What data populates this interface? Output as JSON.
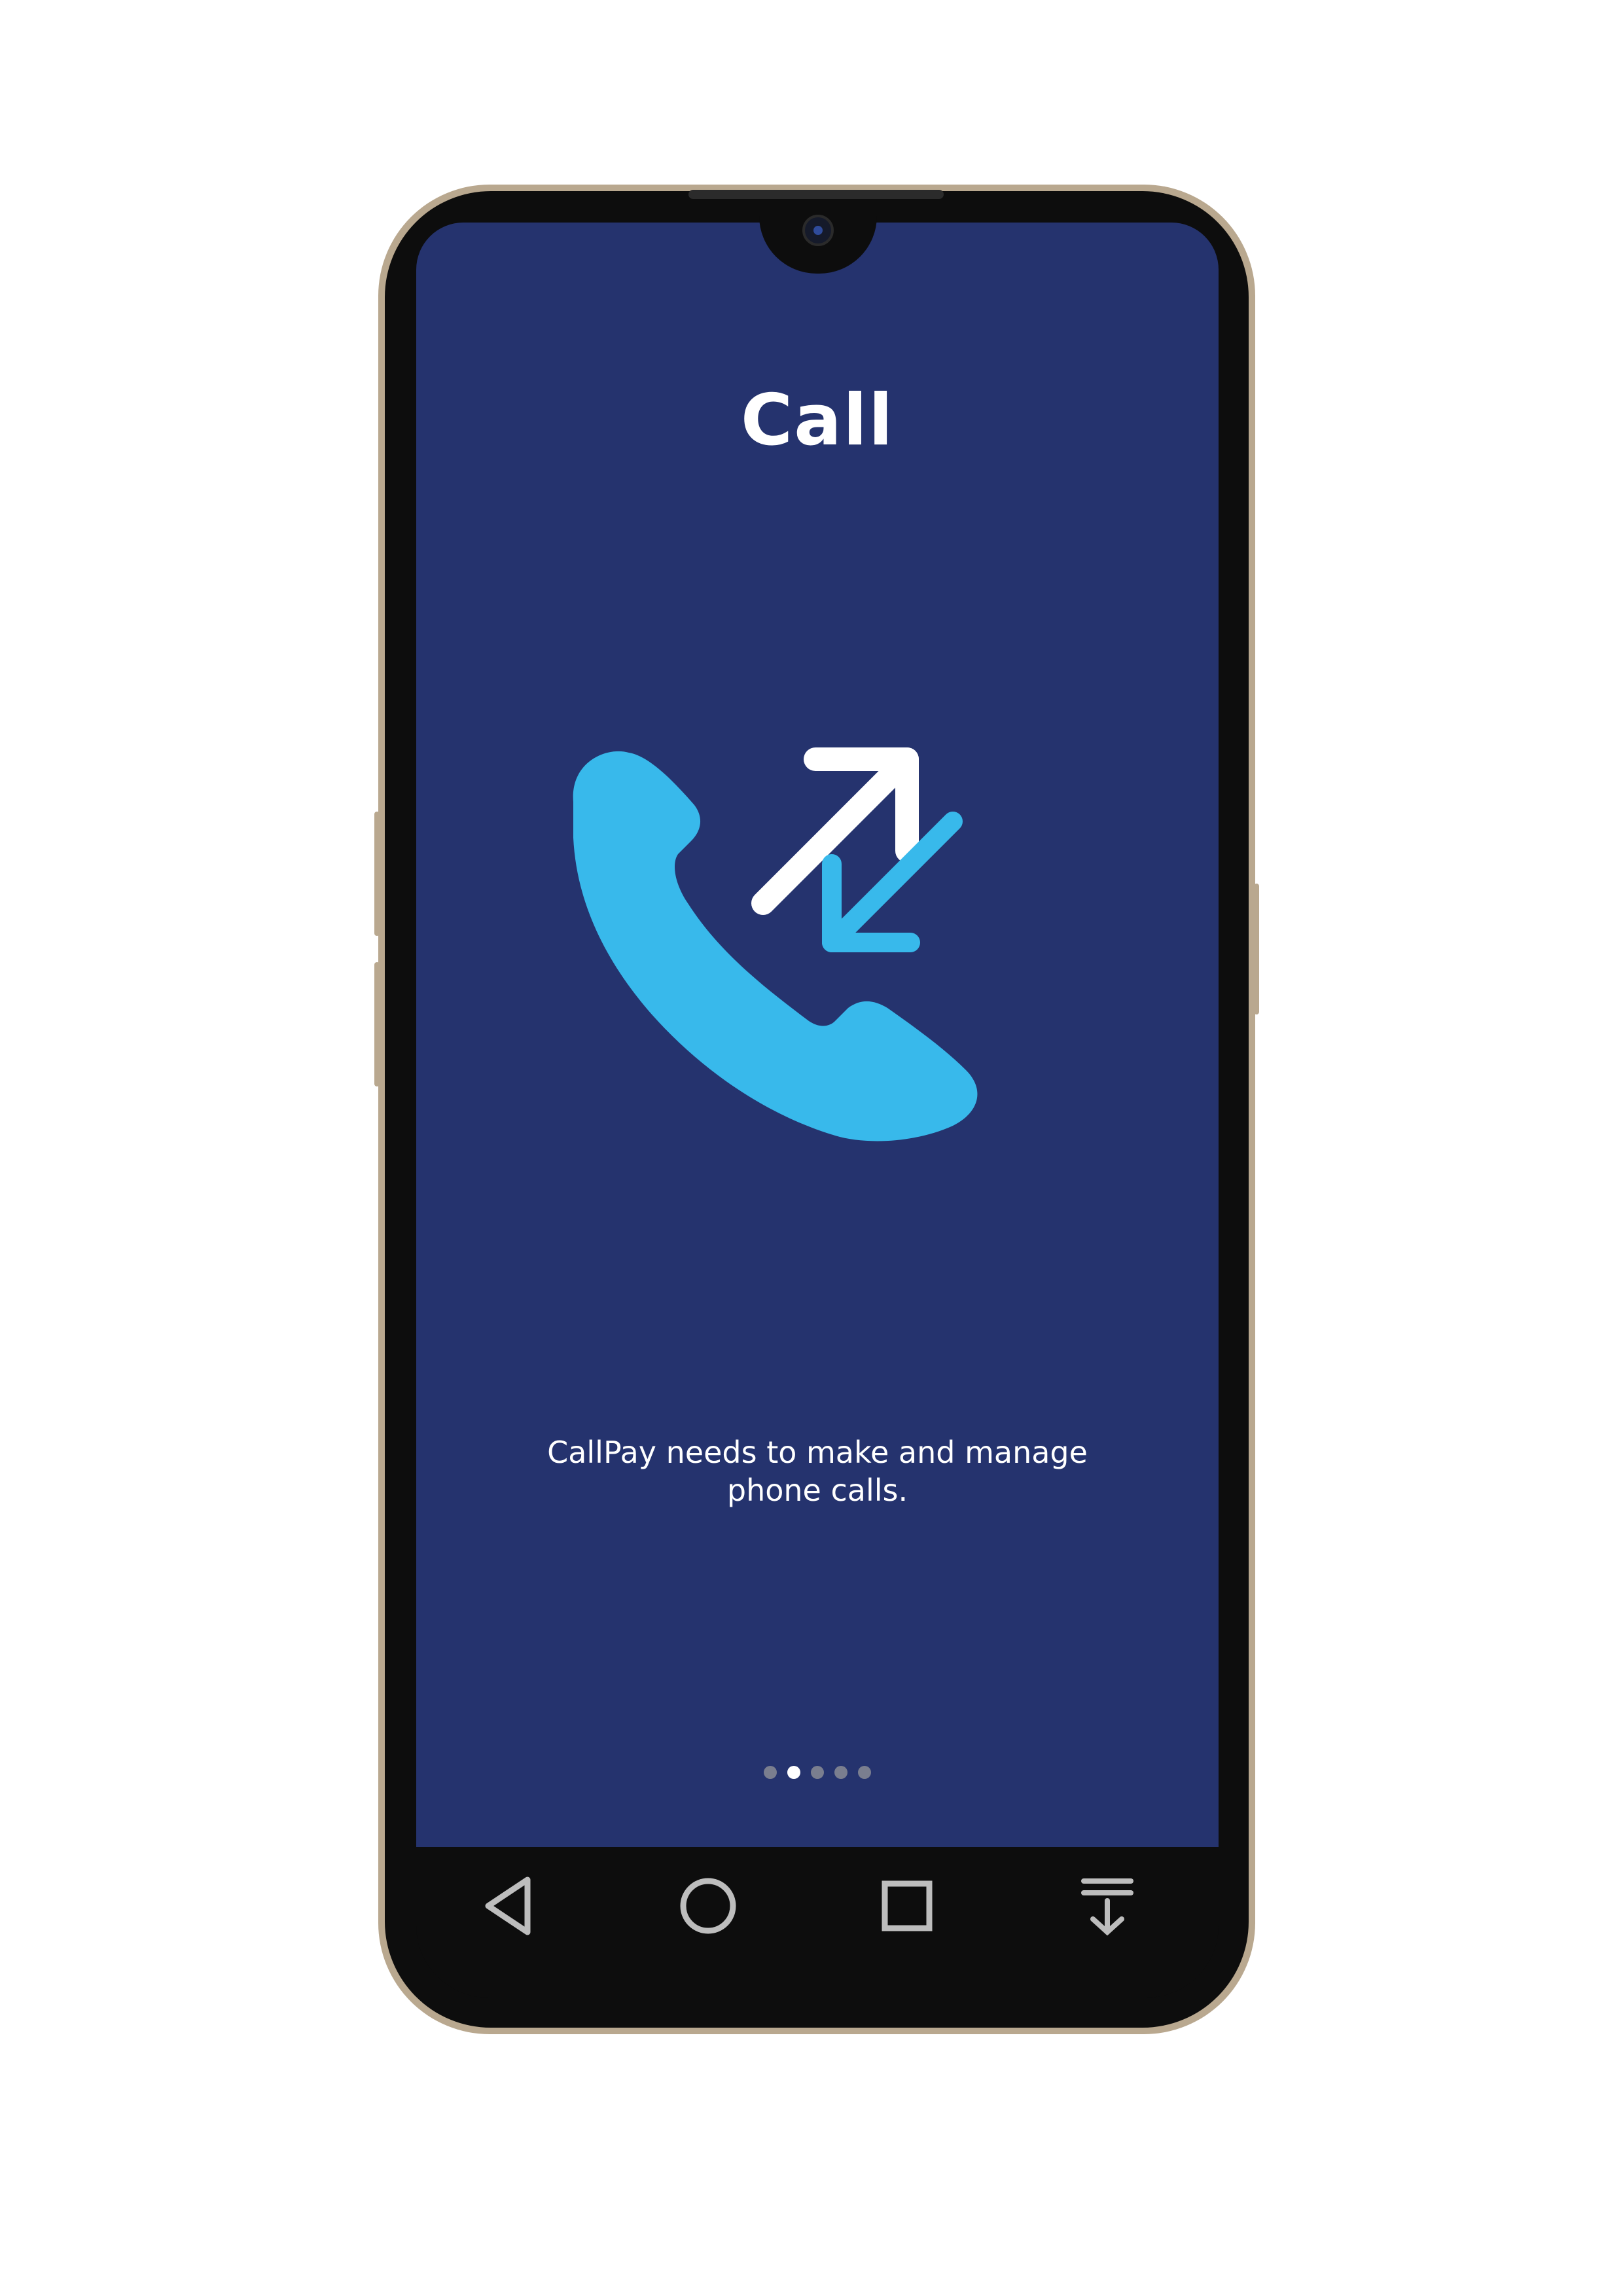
{
  "screen": {
    "title": "Call",
    "description_lines": [
      "CallPay needs to make and manage",
      "phone calls."
    ],
    "illustration_icon": "phone-call-in-out-icon"
  },
  "pager": {
    "total": 5,
    "active_index": 1
  },
  "navbar": {
    "buttons": [
      "back-icon",
      "home-icon",
      "recents-icon",
      "notification-pulldown-icon"
    ]
  },
  "colors": {
    "screen_bg": "#25336e",
    "accent_blue": "#38b9eb",
    "text": "#ffffff"
  }
}
